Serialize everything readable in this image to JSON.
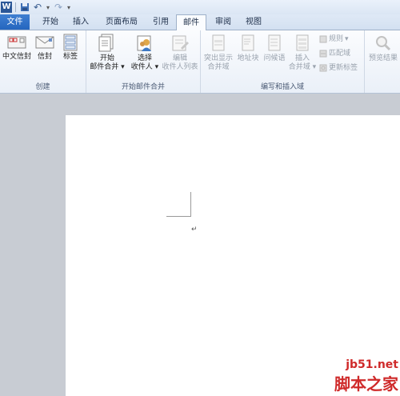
{
  "quick_access": {
    "logo": "W",
    "undo": "↶",
    "redo": "↷",
    "more": "▾"
  },
  "tabs": [
    "文件",
    "开始",
    "插入",
    "页面布局",
    "引用",
    "邮件",
    "审阅",
    "视图"
  ],
  "ribbon": {
    "create": {
      "label": "创建",
      "buttons": [
        "中文信封",
        "信封",
        "标签"
      ]
    },
    "start_merge": {
      "label": "开始邮件合并",
      "start_line1": "开始",
      "start_line2": "邮件合并",
      "select_line1": "选择",
      "select_line2": "收件人",
      "edit_line1": "编辑",
      "edit_line2": "收件人列表"
    },
    "write_insert": {
      "label": "编写和插入域",
      "highlight_line1": "突出显示",
      "highlight_line2": "合并域",
      "address_block": "地址块",
      "greeting": "问候语",
      "insert_line1": "插入",
      "insert_line2": "合并域",
      "rules": "规则",
      "match_fields": "匹配域",
      "update_labels": "更新标签"
    },
    "preview": {
      "label": "预览结果"
    }
  },
  "document": {
    "paragraph_mark": "↵"
  },
  "watermark": {
    "line1": "jb51.net",
    "line2": "脚本之家"
  }
}
